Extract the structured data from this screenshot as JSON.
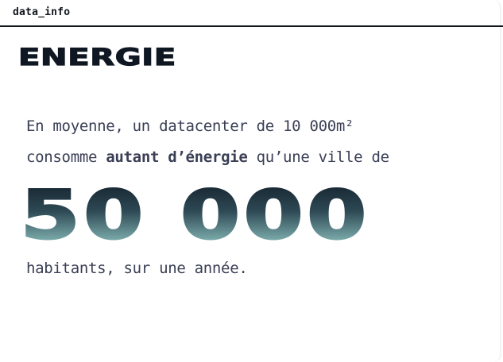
{
  "header": {
    "label": "data_info"
  },
  "title": "ENERGIE",
  "paragraph": {
    "line1": "En moyenne, un datacenter de 10 000m²",
    "line2_prefix": "consomme ",
    "line2_bold": "autant d’énergie",
    "line2_suffix": " qu’une ville de",
    "line3": "habitants, sur une année."
  },
  "highlight": {
    "value": "50 000"
  },
  "colors": {
    "text_dark": "#0f1722",
    "text_body": "#3a3f55",
    "gradient_top": "#101b26",
    "gradient_bottom": "#9fd8d3"
  }
}
